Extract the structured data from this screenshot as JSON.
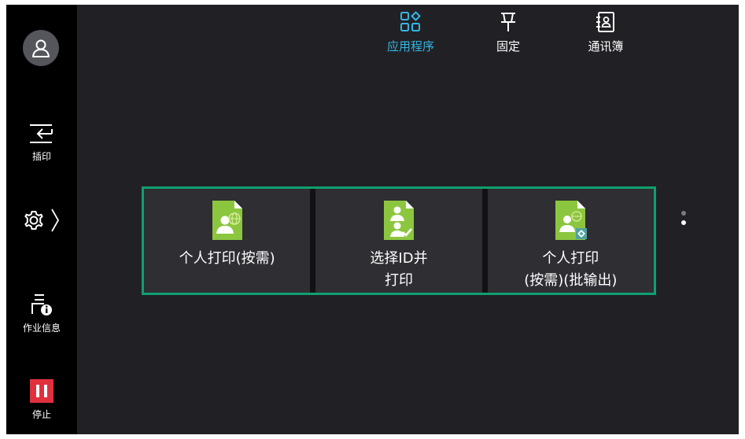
{
  "topnav": {
    "items": [
      {
        "label": "应用程序",
        "active": true
      },
      {
        "label": "固定",
        "active": false
      },
      {
        "label": "通讯簿",
        "active": false
      }
    ]
  },
  "sidebar": {
    "interrupt_label": "插印",
    "job_info_label": "作业信息",
    "stop_label": "停止"
  },
  "tiles": [
    {
      "lines": [
        "个人打印(按需)"
      ]
    },
    {
      "lines": [
        "选择ID并",
        "打印"
      ]
    },
    {
      "lines": [
        "个人打印",
        "(按需)(批输出)"
      ]
    }
  ],
  "pager": {
    "pages": 2,
    "current": 2
  },
  "colors": {
    "accent": "#34b6e4",
    "selection_border": "#0f9f6e",
    "stop": "#e0303e",
    "doc_green": "#8cc63f"
  }
}
